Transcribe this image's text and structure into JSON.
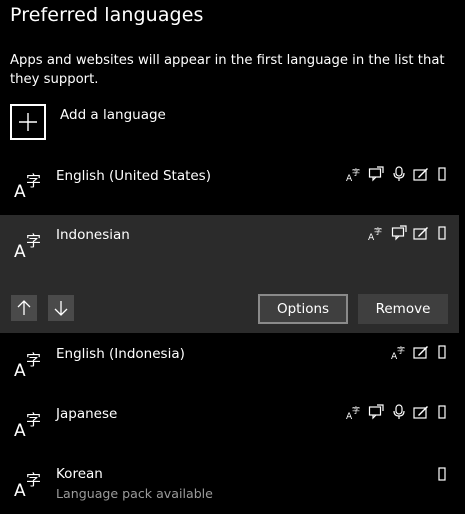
{
  "page": {
    "title": "Preferred languages",
    "description": "Apps and websites will appear in the first language in the list that they support.",
    "add_language_label": "Add a language"
  },
  "languages": [
    {
      "name": "English (United States)",
      "sub": "",
      "features": [
        "display-language",
        "text-to-speech",
        "speech-recognition",
        "handwriting",
        "basic-typing"
      ]
    },
    {
      "name": "Indonesian",
      "sub": "",
      "features": [
        "display-language",
        "text-to-speech",
        "handwriting",
        "basic-typing"
      ],
      "selected": true
    },
    {
      "name": "English (Indonesia)",
      "sub": "",
      "features": [
        "display-language",
        "handwriting",
        "basic-typing"
      ]
    },
    {
      "name": "Japanese",
      "sub": "",
      "features": [
        "display-language",
        "text-to-speech",
        "speech-recognition",
        "handwriting",
        "basic-typing"
      ]
    },
    {
      "name": "Korean",
      "sub": "Language pack available",
      "features": [
        "basic-typing"
      ]
    }
  ],
  "actions": {
    "options_label": "Options",
    "remove_label": "Remove",
    "move_up_icon": "arrow-up-icon",
    "move_down_icon": "arrow-down-icon"
  },
  "colors": {
    "background": "#000000",
    "selected_row": "#2b2b2b",
    "button": "#3f3f3f",
    "button_border": "#8a8a8a",
    "arrow_button": "#4a4a4a",
    "secondary_text": "#9b9b9b"
  }
}
